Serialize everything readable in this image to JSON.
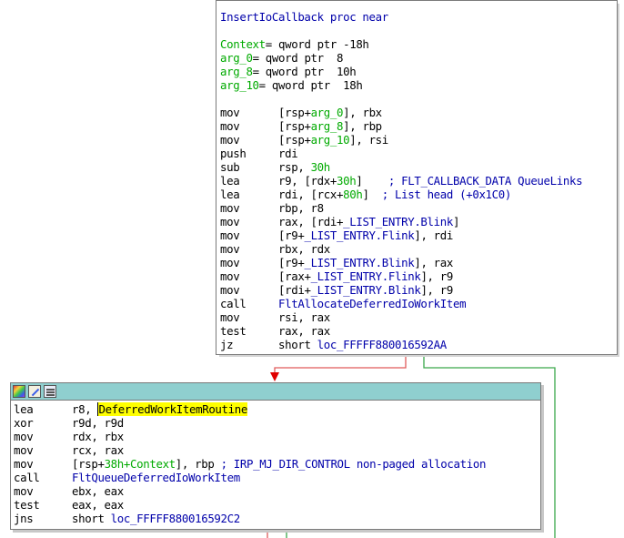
{
  "colors": {
    "node_title_bg": "#8fcfcf",
    "edge_false": "#e05a5a",
    "edge_true": "#3aa84a",
    "keyword_blue": "#0000aa",
    "var_green": "#00aa00",
    "highlight": "#ffff00"
  },
  "node1": {
    "proc_name": "InsertIoCallback",
    "proc_kw": " proc near",
    "vars": [
      {
        "name": "Context",
        "def": "= qword ptr -18h"
      },
      {
        "name": "arg_0",
        "def": "= qword ptr  8"
      },
      {
        "name": "arg_8",
        "def": "= qword ptr  10h"
      },
      {
        "name": "arg_10",
        "def": "= qword ptr  18h"
      }
    ],
    "code": [
      {
        "mn": "mov",
        "a": "[rsp+",
        "b": "arg_0",
        "c": "], rbx"
      },
      {
        "mn": "mov",
        "a": "[rsp+",
        "b": "arg_8",
        "c": "], rbp"
      },
      {
        "mn": "mov",
        "a": "[rsp+",
        "b": "arg_10",
        "c": "], rsi"
      },
      {
        "mn": "push",
        "a": "rdi",
        "b": "",
        "c": ""
      },
      {
        "mn": "sub",
        "a": "rsp, ",
        "b": "30h",
        "c": ""
      },
      {
        "mn": "lea",
        "a": "r9, [rdx+",
        "b": "30h",
        "c": "]",
        "cmt": "    ; FLT_CALLBACK_DATA QueueLinks"
      },
      {
        "mn": "lea",
        "a": "rdi, [rcx+",
        "b": "80h",
        "c": "]",
        "cmt": "  ; List head (+0x1C0)"
      },
      {
        "mn": "mov",
        "a": "rbp, r8",
        "b": "",
        "c": ""
      },
      {
        "mn": "mov",
        "a": "rax, [rdi+",
        "b": "_LIST_ENTRY.Blink",
        "c": "]"
      },
      {
        "mn": "mov",
        "a": "[r9+",
        "b": "_LIST_ENTRY.Flink",
        "c": "], rdi"
      },
      {
        "mn": "mov",
        "a": "rbx, rdx",
        "b": "",
        "c": ""
      },
      {
        "mn": "mov",
        "a": "[r9+",
        "b": "_LIST_ENTRY.Blink",
        "c": "], rax"
      },
      {
        "mn": "mov",
        "a": "[rax+",
        "b": "_LIST_ENTRY.Flink",
        "c": "], r9"
      },
      {
        "mn": "mov",
        "a": "[rdi+",
        "b": "_LIST_ENTRY.Blink",
        "c": "], r9"
      },
      {
        "mn": "call",
        "a": "",
        "b": "FltAllocateDeferredIoWorkItem",
        "c": ""
      },
      {
        "mn": "mov",
        "a": "rsi, rax",
        "b": "",
        "c": ""
      },
      {
        "mn": "test",
        "a": "rax, rax",
        "b": "",
        "c": ""
      },
      {
        "mn": "jz",
        "a": "short ",
        "b": "loc_FFFFF880016592AA",
        "c": ""
      }
    ]
  },
  "node2": {
    "code": [
      {
        "mn": "lea",
        "a": "r8, ",
        "b": "DeferredWorkItemRoutine",
        "c": ""
      },
      {
        "mn": "xor",
        "a": "r9d, r9d",
        "b": "",
        "c": ""
      },
      {
        "mn": "mov",
        "a": "rdx, rbx",
        "b": "",
        "c": ""
      },
      {
        "mn": "mov",
        "a": "rcx, rax",
        "b": "",
        "c": ""
      },
      {
        "mn": "mov",
        "a": "[rsp+",
        "b": "38h",
        "b2": "+Context",
        "c": "], rbp",
        "cmt": " ; IRP_MJ_DIR_CONTROL non-paged allocation"
      },
      {
        "mn": "call",
        "a": "",
        "b": "FltQueueDeferredIoWorkItem",
        "c": ""
      },
      {
        "mn": "mov",
        "a": "ebx, eax",
        "b": "",
        "c": ""
      },
      {
        "mn": "test",
        "a": "eax, eax",
        "b": "",
        "c": ""
      },
      {
        "mn": "jns",
        "a": "short ",
        "b": "loc_FFFFF880016592C2",
        "c": ""
      }
    ]
  }
}
